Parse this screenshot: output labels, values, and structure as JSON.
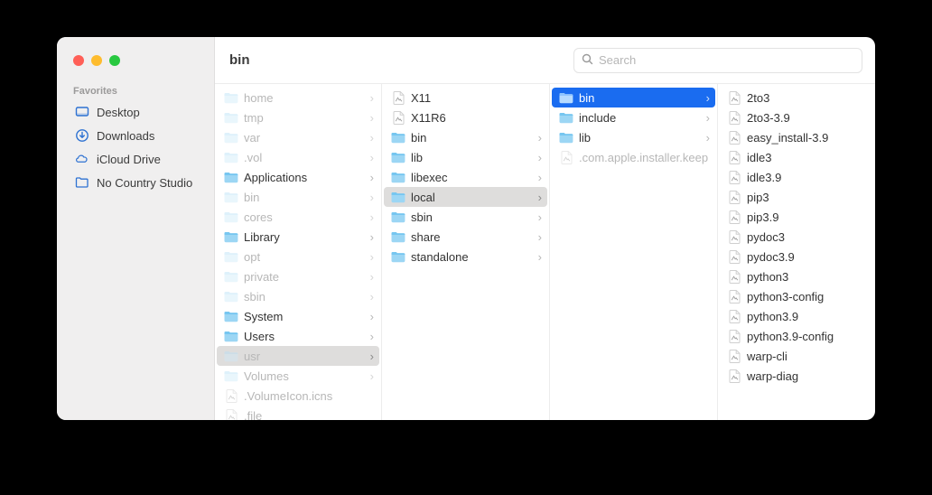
{
  "window": {
    "title": "bin"
  },
  "search": {
    "placeholder": "Search"
  },
  "sidebar": {
    "section_label": "Favorites",
    "items": [
      {
        "label": "Desktop",
        "icon": "desktop-icon"
      },
      {
        "label": "Downloads",
        "icon": "downloads-icon"
      },
      {
        "label": "iCloud Drive",
        "icon": "icloud-icon"
      },
      {
        "label": "No Country Studio",
        "icon": "folder-icon"
      }
    ]
  },
  "columns": [
    {
      "items": [
        {
          "name": "home",
          "type": "folder",
          "dim": true,
          "arrow": true
        },
        {
          "name": "tmp",
          "type": "folder",
          "dim": true,
          "arrow": true
        },
        {
          "name": "var",
          "type": "folder",
          "dim": true,
          "arrow": true
        },
        {
          "name": ".vol",
          "type": "folder",
          "dim": true,
          "arrow": true
        },
        {
          "name": "Applications",
          "type": "folder",
          "arrow": true
        },
        {
          "name": "bin",
          "type": "folder",
          "dim": true,
          "arrow": true
        },
        {
          "name": "cores",
          "type": "folder",
          "dim": true,
          "arrow": true
        },
        {
          "name": "Library",
          "type": "folder",
          "arrow": true
        },
        {
          "name": "opt",
          "type": "folder",
          "dim": true,
          "arrow": true
        },
        {
          "name": "private",
          "type": "folder",
          "dim": true,
          "arrow": true
        },
        {
          "name": "sbin",
          "type": "folder",
          "dim": true,
          "arrow": true
        },
        {
          "name": "System",
          "type": "folder",
          "arrow": true
        },
        {
          "name": "Users",
          "type": "folder",
          "arrow": true
        },
        {
          "name": "usr",
          "type": "folder",
          "dim": true,
          "arrow": true,
          "state": "path"
        },
        {
          "name": "Volumes",
          "type": "folder",
          "dim": true,
          "arrow": true
        },
        {
          "name": ".VolumeIcon.icns",
          "type": "file",
          "dim": true
        },
        {
          "name": ".file",
          "type": "file",
          "dim": true
        }
      ]
    },
    {
      "items": [
        {
          "name": "X11",
          "type": "file"
        },
        {
          "name": "X11R6",
          "type": "file"
        },
        {
          "name": "bin",
          "type": "folder",
          "arrow": true
        },
        {
          "name": "lib",
          "type": "folder",
          "arrow": true
        },
        {
          "name": "libexec",
          "type": "folder",
          "arrow": true
        },
        {
          "name": "local",
          "type": "folder",
          "arrow": true,
          "state": "path"
        },
        {
          "name": "sbin",
          "type": "folder",
          "arrow": true
        },
        {
          "name": "share",
          "type": "folder",
          "arrow": true
        },
        {
          "name": "standalone",
          "type": "folder",
          "arrow": true
        }
      ]
    },
    {
      "items": [
        {
          "name": "bin",
          "type": "folder",
          "arrow": true,
          "state": "selected"
        },
        {
          "name": "include",
          "type": "folder",
          "arrow": true
        },
        {
          "name": "lib",
          "type": "folder",
          "arrow": true
        },
        {
          "name": ".com.apple.installer.keep",
          "type": "file",
          "dim": true
        }
      ]
    },
    {
      "items": [
        {
          "name": "2to3",
          "type": "file"
        },
        {
          "name": "2to3-3.9",
          "type": "file"
        },
        {
          "name": "easy_install-3.9",
          "type": "file"
        },
        {
          "name": "idle3",
          "type": "file"
        },
        {
          "name": "idle3.9",
          "type": "file"
        },
        {
          "name": "pip3",
          "type": "file"
        },
        {
          "name": "pip3.9",
          "type": "file"
        },
        {
          "name": "pydoc3",
          "type": "file"
        },
        {
          "name": "pydoc3.9",
          "type": "file"
        },
        {
          "name": "python3",
          "type": "file"
        },
        {
          "name": "python3-config",
          "type": "file"
        },
        {
          "name": "python3.9",
          "type": "file"
        },
        {
          "name": "python3.9-config",
          "type": "file"
        },
        {
          "name": "warp-cli",
          "type": "file"
        },
        {
          "name": "warp-diag",
          "type": "file"
        }
      ]
    }
  ]
}
